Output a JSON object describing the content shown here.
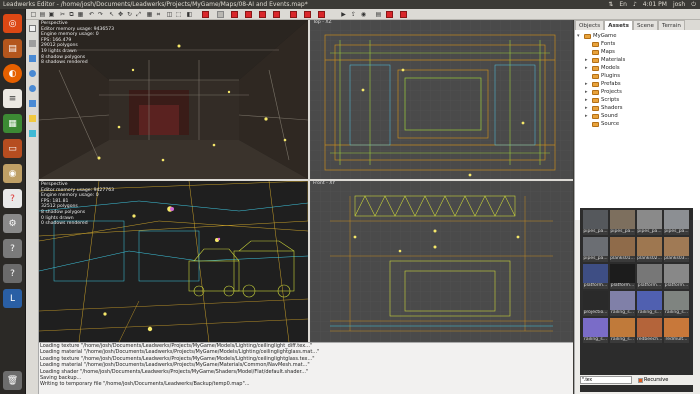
{
  "window_title": "Leadwerks Editor - /home/josh/Documents/Leadwerks/Projects/MyGame/Maps/08-AI and Events.map*",
  "tray": {
    "time": "4:01 PM",
    "user": "josh"
  },
  "viewports": {
    "perspective": {
      "label": "Perspective",
      "stats": [
        "Perspective",
        "Editor memory usage: 9436573",
        "Engine memory usage: 0",
        "FPS: 166.479",
        "29012 polygons",
        "19 lights drawn",
        "8 shadow polygons",
        "8 shadows rendered"
      ]
    },
    "top": {
      "label": "Top - XZ"
    },
    "wire": {
      "stats": [
        "Perspective",
        "Editor memory usage: 9427763",
        "Engine memory usage: 0",
        "FPS: 181.81",
        "32512 polygons",
        "8 shadow polygons",
        "0 lights drawn",
        "0 shadows rendered"
      ]
    },
    "front": {
      "label": "Front - XY"
    }
  },
  "console": [
    "Loading texture \"/home/josh/Documents/Leadwerks/Projects/MyGame/Models/Lighting/ceilinglight_diff.tex...\"",
    "Loading material \"/home/josh/Documents/Leadwerks/Projects/MyGame/Models/Lighting/ceilinglightglass.mat...\"",
    "Loading texture \"/home/josh/Documents/Leadwerks/Projects/MyGame/Models/Lighting/ceilinglightglass.tex...\"",
    "Loading material \"/home/josh/Documents/Leadwerks/Projects/MyGame/Materials/Common/NavMesh.mat...\"",
    "Loading shader \"/home/josh/Documents/Leadwerks/Projects/MyGame/Shaders/Model/Flat/default.shader...\"",
    "Saving backup...",
    "Writing to temporary file \"/home/josh/Documents/Leadwerks/Backup/temp0.map\"..."
  ],
  "panel_tabs": [
    "Objects",
    "Assets",
    "Scene",
    "Terrain"
  ],
  "active_tab": "Assets",
  "tree": {
    "root": "MyGame",
    "children": [
      "Fonts",
      "Maps",
      "Materials",
      "Models",
      "Plugins",
      "Prefabs",
      "Projects",
      "Scripts",
      "Shaders",
      "Sound",
      "Source"
    ]
  },
  "thumbnails": [
    {
      "label": "pipes_pa...",
      "color": "#55585c"
    },
    {
      "label": "pipes_pa...",
      "color": "#7d6f5e"
    },
    {
      "label": "pipes_pa...",
      "color": "#8a8a8a"
    },
    {
      "label": "pipes_pa...",
      "color": "#8c8f93"
    },
    {
      "label": "pipes_pa...",
      "color": "#6b6e73"
    },
    {
      "label": "planks01...",
      "color": "#8f6b4a"
    },
    {
      "label": "planks02...",
      "color": "#9e7750"
    },
    {
      "label": "planks03...",
      "color": "#a07a55"
    },
    {
      "label": "platform...",
      "color": "#3e4e84"
    },
    {
      "label": "platform...",
      "color": "#1c1c1c"
    },
    {
      "label": "platform...",
      "color": "#777777"
    },
    {
      "label": "platform...",
      "color": "#888888"
    },
    {
      "label": "projectio...",
      "color": "#2a2a2a"
    },
    {
      "label": "railing_s...",
      "color": "#8080a8"
    },
    {
      "label": "railing_s...",
      "color": "#5060b0"
    },
    {
      "label": "railing_s...",
      "color": "#7f8480"
    },
    {
      "label": "railing_s...",
      "color": "#7a6cc8"
    },
    {
      "label": "railing_s...",
      "color": "#c07a3a"
    },
    {
      "label": "redbeech...",
      "color": "#b4643a"
    },
    {
      "label": "redmult...",
      "color": "#c8783a"
    }
  ],
  "search": {
    "value": "*.tex",
    "recursive_label": "Recursive"
  },
  "colors": {
    "accent": "#dd4814",
    "folder": "#e8a33c"
  }
}
